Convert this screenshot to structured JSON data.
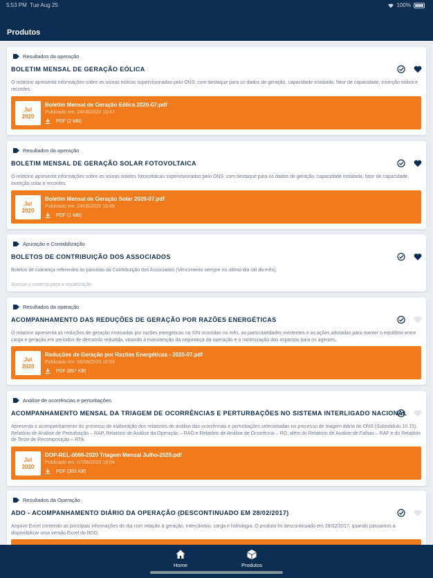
{
  "status_bar": {
    "time": "5:53 PM",
    "date": "Tue Aug 25",
    "battery": "100%"
  },
  "nav": {
    "title": "Produtos"
  },
  "cards": [
    {
      "category": "Resultados da operação",
      "title": "BOLETIM MENSAL DE GERAÇÃO EÓLICA",
      "description": "O relatório apresenta informações sobre as usinas eólicas supervisionadas pelo ONS, com destaque para os dados de geração, capacidade instalada, fator de capacidade, inserção eólica e recordes.",
      "favorited": true,
      "file": {
        "month": "Jul",
        "year": "2020",
        "name": "Boletim Mensal de Geração Eólica 2020-07.pdf",
        "published": "Publicado em: 24/08/2020 19:47",
        "size": "PDF (2 MB)"
      }
    },
    {
      "category": "Resultados da operação",
      "title": "BOLETIM MENSAL DE GERAÇÃO SOLAR FOTOVOLTAICA",
      "description": "O relatório apresenta informações sobre as usinas solares fotovoltaicas supervisionadas pelo ONS, com destaque para os dados de geração, capacidade instalada, fator de capacidade, inserção solar e recordes.",
      "favorited": true,
      "file": {
        "month": "Jul",
        "year": "2020",
        "name": "Boletim Mensal de Geração Solar 2020-07.pdf",
        "published": "Publicado em: 24/08/2020 19:49",
        "size": "PDF (1 MB)"
      }
    },
    {
      "category": "Apuração e Contabilização",
      "title": "BOLETOS DE CONTRIBUIÇÃO DOS ASSOCIADOS",
      "description": "Boletos de cobrança referentes às parcelas da Contribuição dos Associados (Vencimento sempre no último dia útil do mês).",
      "favorited": true,
      "access_note": "Acesse o sistema para a visualização"
    },
    {
      "category": "Resultados da operação",
      "title": "ACOMPANHAMENTO DAS REDUÇÕES DE GERAÇÃO POR RAZÕES ENERGÉTICAS",
      "description": "O relatório apresenta as reduções de geração motivadas por razões energéticas no SIN ocorridas no mês, as particularidades existentes e as ações adotadas para manter o equilíbrio entre carga e geração em períodos de demanda reduzida, visando à manutenção da segurança da operação e a minimização dos impactos para os agentes.",
      "favorited": false,
      "file": {
        "month": "Jul",
        "year": "2020",
        "name": "Reduções de Geração por Razões Energéticas - 2020-07.pdf",
        "published": "Publicado em: 06/08/2020 10:53",
        "size": "PDF (857 KB)"
      }
    },
    {
      "category": "Análise de ocorrências e perturbações",
      "title": "ACOMPANHAMENTO MENSAL DA TRIAGEM DE OCORRÊNCIAS E PERTURBAÇÕES NO SISTEMA INTERLIGADO NACIONAL",
      "description": "Apresenta o acompanhamento do processo de elaboração dos relatórios de análise das ocorrências e perturbações selecionadas no processo de triagem diária do ONS (Submódulo 10.15). Relatório de Análise de Perturbação – RAP, Relatório de Análise da Operação – RAO e Relatório de Análise de Ocorrência – RO, além do Relatório de Análise de Falhas – RAF e do Relatório de Teste de Recomposição – RTA.",
      "favorited": false,
      "file": {
        "month": "Jul",
        "year": "2020",
        "name": "DOP-REL-0069-2020 Triagem Mensal Julho-2020.pdf",
        "published": "Publicado em: 07/08/2020 18:04",
        "size": "PDF (353 KB)"
      }
    },
    {
      "category": "Resultados da Operação",
      "title": "ADO - ACOMPANHAMENTO DIÁRIO DA OPERAÇÃO (DESCONTINUADO EM 28/02/2017)",
      "description": "Arquivo Excel contendo as principais informações do dia com relação à geração, intercâmbio, carga e hidrologia.   O produto foi descontinuado em 28/02/2017, quando passamos a disponibilizar uma versão Excel do BDO.",
      "favorited": false
    }
  ],
  "tabs": [
    {
      "label": "Home",
      "icon": "home-icon",
      "active": false
    },
    {
      "label": "Produtos",
      "icon": "cube-icon",
      "active": true
    }
  ],
  "colors": {
    "navy": "#0c2d52",
    "orange": "#f07a1c",
    "background": "#e9edf2",
    "title": "#0e2c4f"
  }
}
